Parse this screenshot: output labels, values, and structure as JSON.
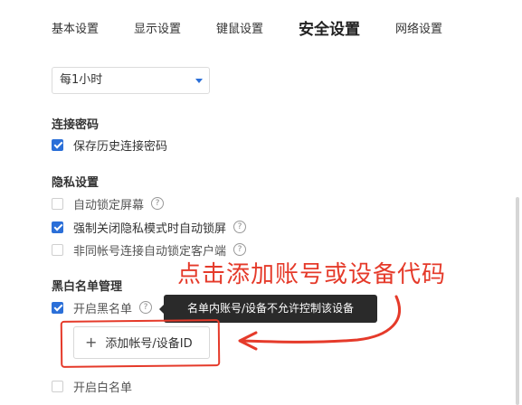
{
  "tabs": [
    {
      "label": "基本设置"
    },
    {
      "label": "显示设置"
    },
    {
      "label": "键鼠设置"
    },
    {
      "label": "安全设置",
      "active": true
    },
    {
      "label": "网络设置"
    }
  ],
  "lock_select": {
    "value": "每1小时"
  },
  "connection_password": {
    "title": "连接密码",
    "save_history": {
      "label": "保存历史连接密码",
      "checked": true
    }
  },
  "privacy": {
    "title": "隐私设置",
    "auto_lock": {
      "label": "自动锁定屏幕",
      "checked": false
    },
    "force_close_lock": {
      "label": "强制关闭隐私模式时自动锁屏",
      "checked": true
    },
    "diff_account_lock": {
      "label": "非同帐号连接自动锁定客户端",
      "checked": false
    }
  },
  "blacklist": {
    "title": "黑白名单管理",
    "enable_blacklist": {
      "label": "开启黑名单",
      "checked": true
    },
    "tooltip": "名单内账号/设备不允许控制该设备",
    "add_button": "添加帐号/设备ID",
    "enable_whitelist": {
      "label": "开启白名单",
      "checked": false
    }
  },
  "annotation": {
    "text": "点击添加账号或设备代码",
    "color": "#e53a2a"
  },
  "colors": {
    "accent": "#2b6fd8",
    "annotation_red": "#e53a2a",
    "tooltip_bg": "#2a2a2a"
  },
  "help_icon_glyph": "?"
}
